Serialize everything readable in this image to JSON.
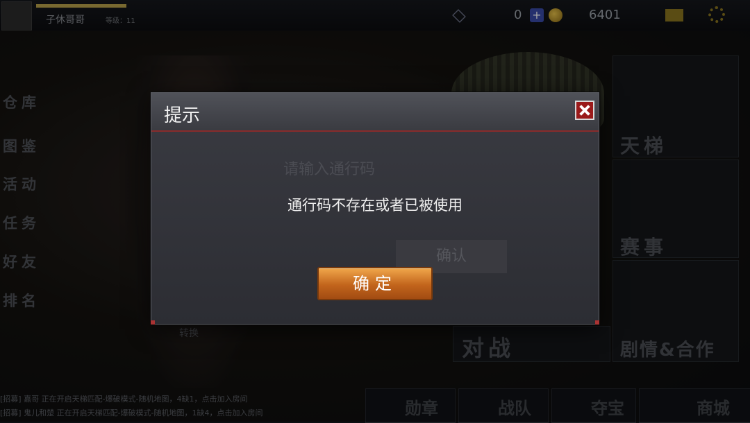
{
  "topbar": {
    "username": "子休哥哥",
    "level_text": "等级：11",
    "gem_count": "0",
    "plus": "+",
    "coin_count": "6401"
  },
  "left_menu": [
    "仓库",
    "图鉴",
    "活动",
    "任务",
    "好友",
    "排名"
  ],
  "right_tiles": {
    "ladder": "天梯",
    "event": "赛事",
    "battle": "对战",
    "story": "剧情&合作"
  },
  "bottom_tabs": [
    "勋章",
    "战队",
    "夺宝",
    "商城"
  ],
  "chat_lines": [
    "[招募] 嘉哥  正在开启天梯匹配-爆破模式-随机地图，4缺1，点击加入房间",
    "[招募] 鬼儿和楚  正在开启天梯匹配-爆破模式-随机地图，1缺4，点击加入房间"
  ],
  "dialog": {
    "title": "提示",
    "ghost_prompt": "请输入通行码",
    "ghost_confirm": "确认",
    "message": "通行码不存在或者已被使用",
    "confirm_label": "确定"
  },
  "exchange_label": "转换"
}
